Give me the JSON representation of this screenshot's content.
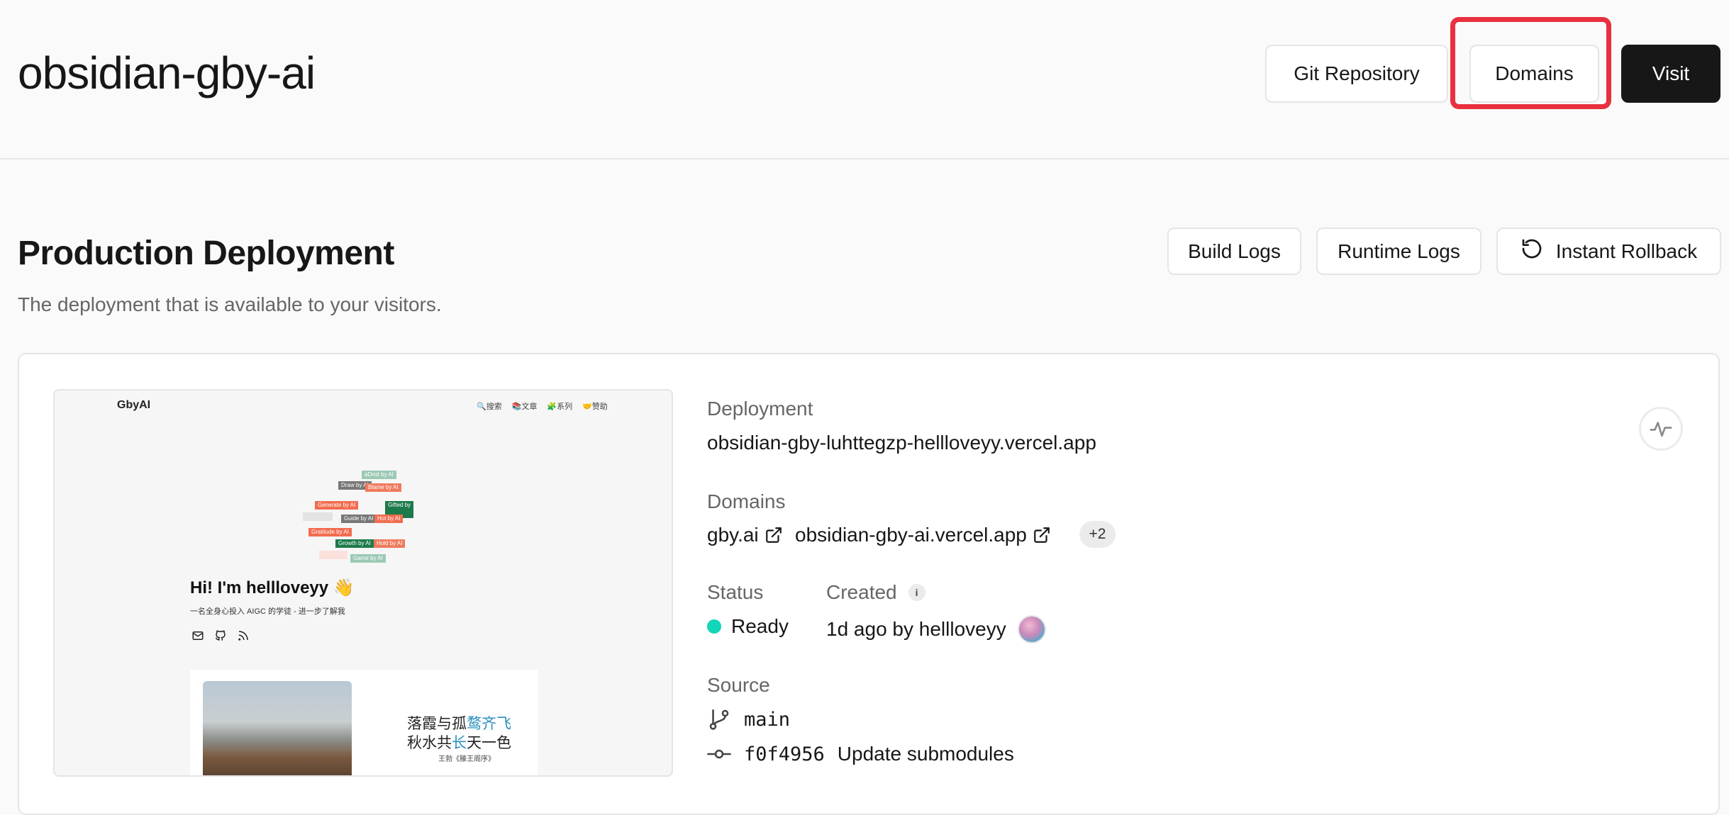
{
  "header": {
    "project_title": "obsidian-gby-ai",
    "git_repository_label": "Git Repository",
    "domains_label": "Domains",
    "visit_label": "Visit",
    "highlight_color": "#e8303f"
  },
  "section": {
    "title": "Production Deployment",
    "subtitle": "The deployment that is available to your visitors.",
    "build_logs_label": "Build Logs",
    "runtime_logs_label": "Runtime Logs",
    "instant_rollback_label": "Instant Rollback"
  },
  "preview": {
    "logo": "GbyAI",
    "nav": [
      "🔍搜索",
      "📚文章",
      "🧩系列",
      "🤝赞助"
    ],
    "tags": [
      "aDmit by AI",
      "Draw by AI",
      "Blame by AI",
      "Generate by AI",
      "Gifted by",
      "Guide by AI",
      "Hot by AI",
      "Gratitude by AI",
      "Growth by AI",
      "Hold by AI",
      "Game by AI"
    ],
    "greeting": "Hi! I'm hellloveyy 👋",
    "description": "一名全身心投入 AIGC 的学徒 - 进一步了解我",
    "poem_line1_a": "落霞与孤",
    "poem_line1_b": "鹜齐飞",
    "poem_line2_a": "秋水共",
    "poem_line2_b": "长",
    "poem_line2_c": "天一色",
    "poem_author": "王勃《滕王阁序》"
  },
  "details": {
    "deployment_label": "Deployment",
    "deployment_url": "obsidian-gby-luhttegzp-hellloveyy.vercel.app",
    "domains_label": "Domains",
    "domain_1": "gby.ai",
    "domain_2": "obsidian-gby-ai.vercel.app",
    "extra_domains": "+2",
    "status_label": "Status",
    "status_value": "Ready",
    "status_color": "#12d6b8",
    "created_label": "Created",
    "created_info": "i",
    "created_value": "1d ago by hellloveyy",
    "source_label": "Source",
    "branch": "main",
    "commit_hash": "f0f4956",
    "commit_message": "Update submodules"
  }
}
